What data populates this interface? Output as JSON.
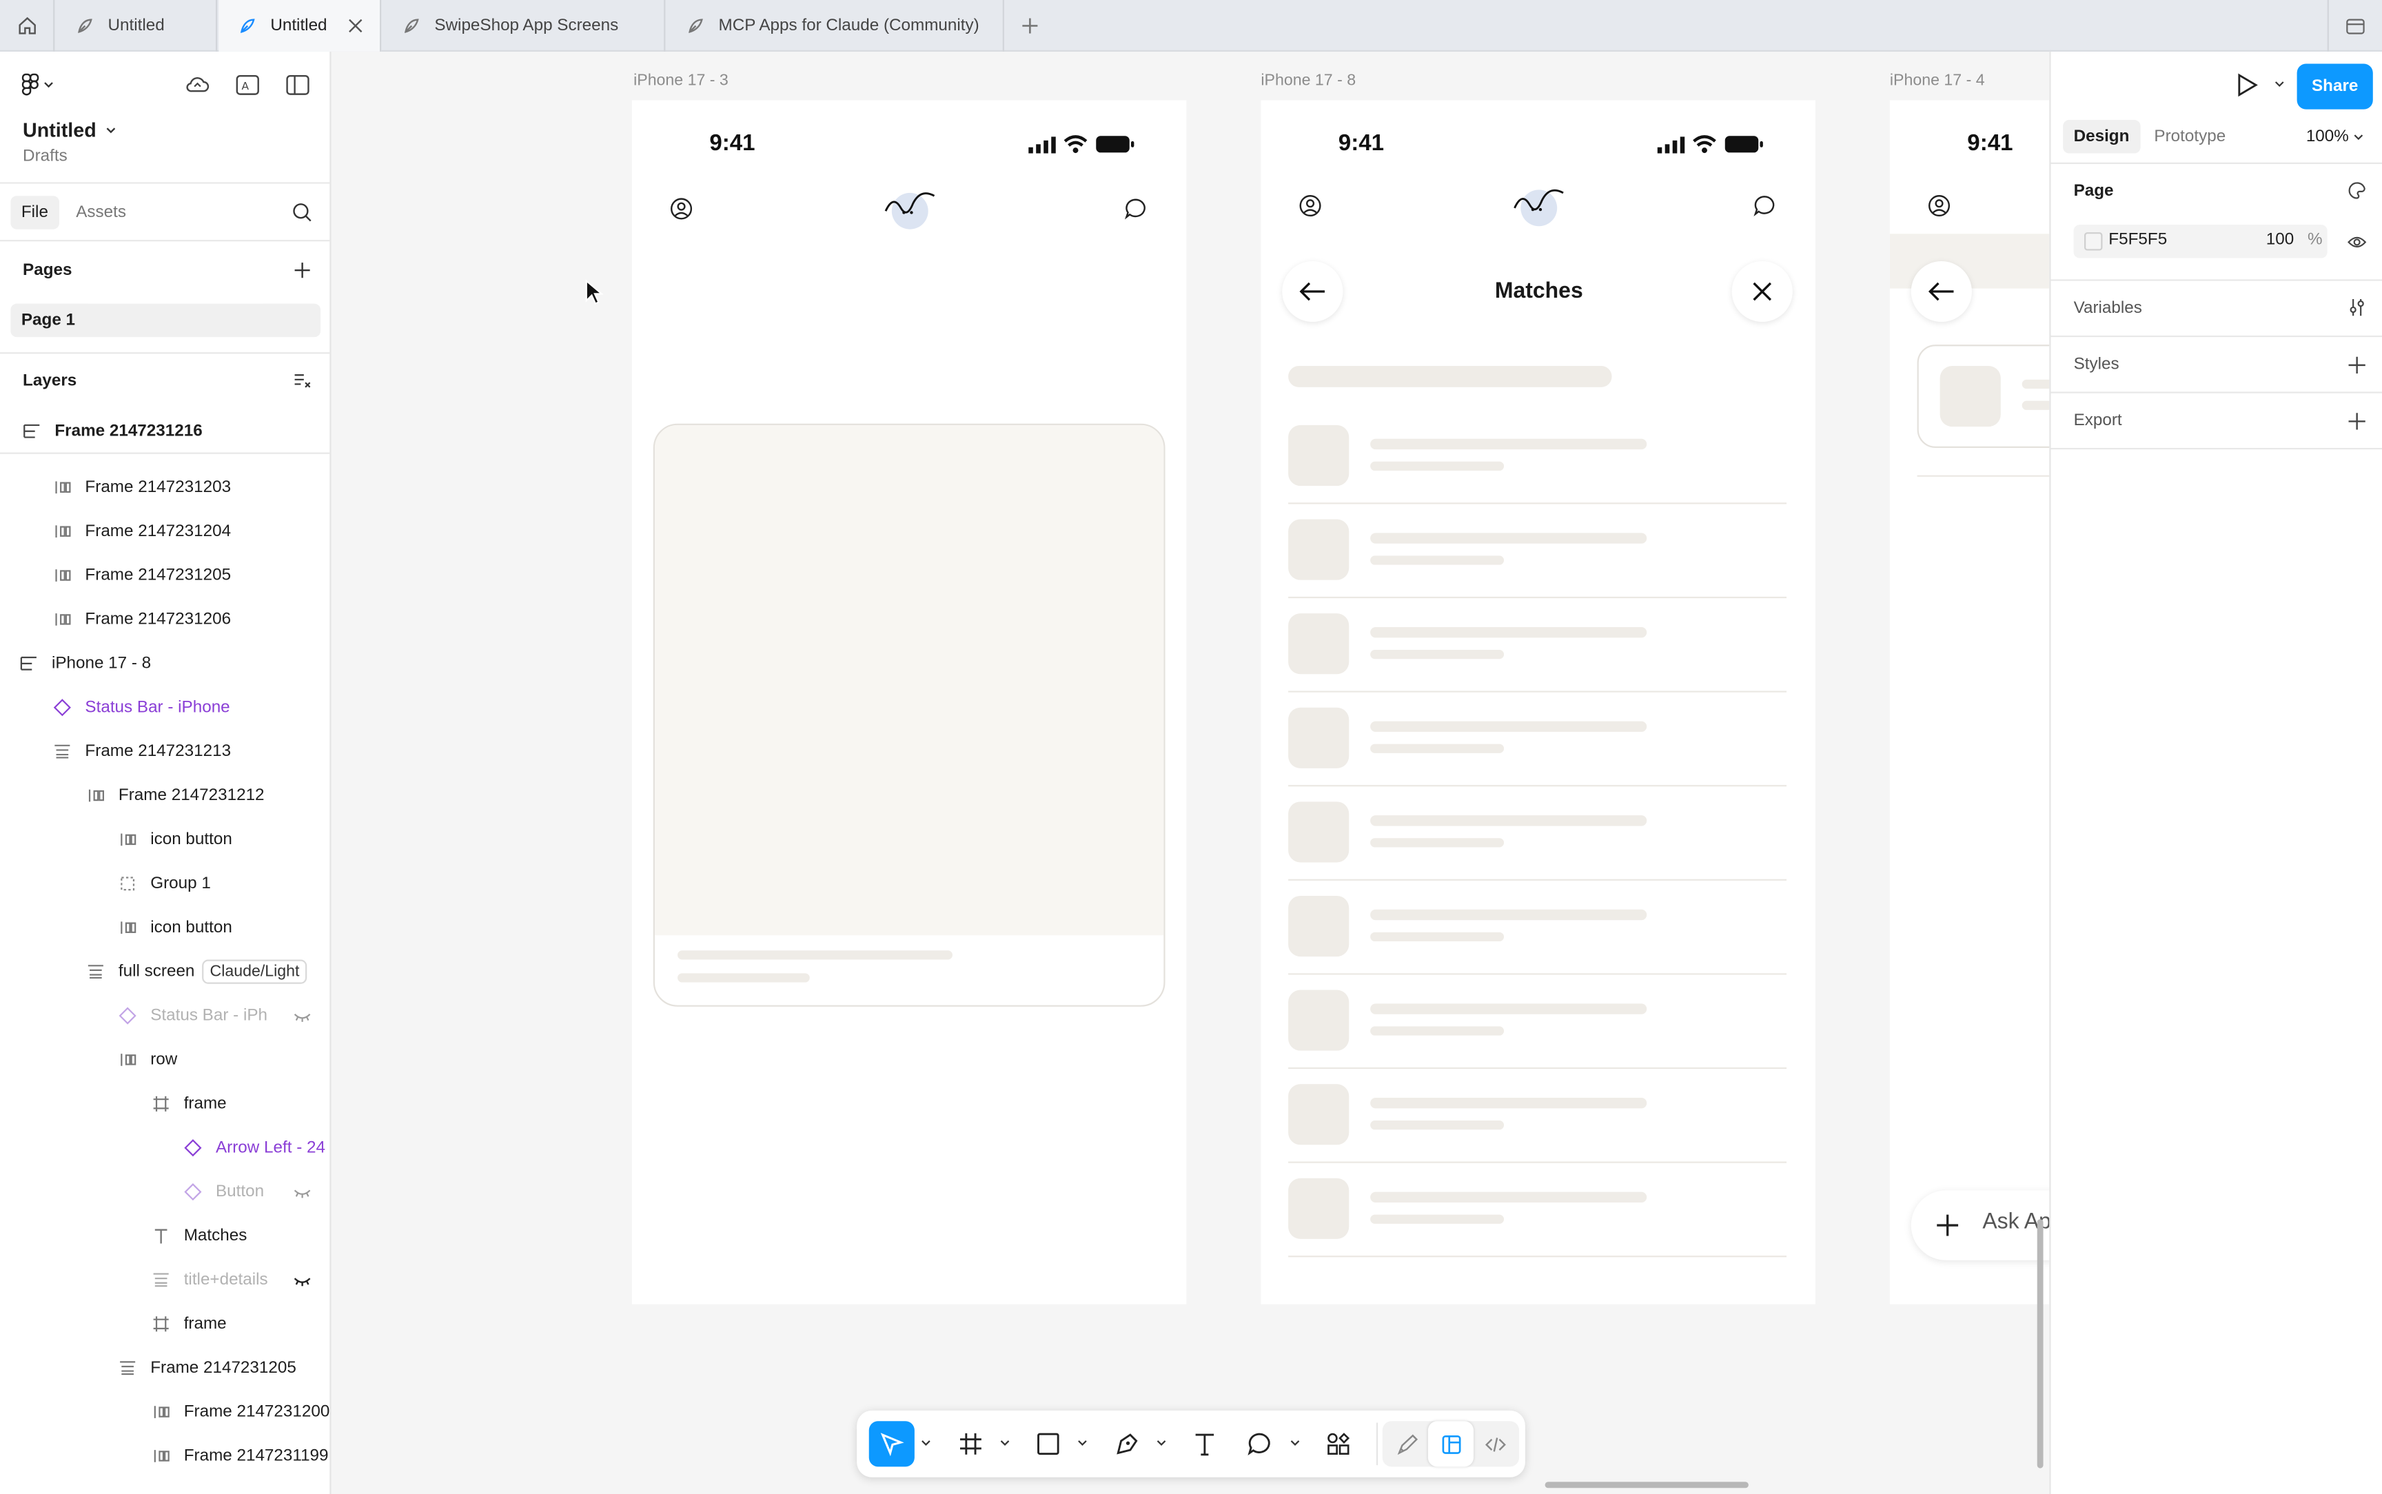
{
  "tabs": [
    {
      "label": "Untitled",
      "active": false
    },
    {
      "label": "Untitled",
      "active": true
    },
    {
      "label": "SwipeShop App Screens",
      "active": false
    },
    {
      "label": "MCP Apps for Claude (Community)",
      "active": false
    }
  ],
  "file": {
    "title": "Untitled",
    "location": "Drafts"
  },
  "left_tabs": {
    "file": "File",
    "assets": "Assets"
  },
  "pages": {
    "header": "Pages",
    "items": [
      "Page 1"
    ]
  },
  "layers": {
    "header": "Layers",
    "items": [
      {
        "label": "Frame 2147231216",
        "icon": "section-icon"
      },
      {
        "label": "Frame 2147231203",
        "icon": "auto-layout-icon"
      },
      {
        "label": "Frame 2147231204",
        "icon": "auto-layout-icon"
      },
      {
        "label": "Frame 2147231205",
        "icon": "auto-layout-icon"
      },
      {
        "label": "Frame 2147231206",
        "icon": "auto-layout-icon"
      },
      {
        "label": "iPhone 17 - 8",
        "icon": "section-icon"
      },
      {
        "label": "Status Bar - iPhone",
        "icon": "component-icon"
      },
      {
        "label": "Frame 2147231213",
        "icon": "auto-layout-icon"
      },
      {
        "label": "Frame 2147231212",
        "icon": "auto-layout-icon"
      },
      {
        "label": "icon button",
        "icon": "auto-layout-icon"
      },
      {
        "label": "Group 1",
        "icon": "group-icon"
      },
      {
        "label": "icon button",
        "icon": "auto-layout-icon"
      },
      {
        "label": "full screen",
        "icon": "auto-layout-icon",
        "chip": "Claude/Light"
      },
      {
        "label": "Status Bar - iPh",
        "icon": "component-icon"
      },
      {
        "label": "row",
        "icon": "auto-layout-icon"
      },
      {
        "label": "frame",
        "icon": "frame-icon"
      },
      {
        "label": "Arrow Left - 24",
        "icon": "component-icon"
      },
      {
        "label": "Button",
        "icon": "component-icon"
      },
      {
        "label": "Matches",
        "icon": "text-icon"
      },
      {
        "label": "title+details",
        "icon": "auto-layout-icon"
      },
      {
        "label": "frame",
        "icon": "frame-icon"
      },
      {
        "label": "Frame 2147231205",
        "icon": "auto-layout-icon"
      },
      {
        "label": "Frame 2147231200",
        "icon": "auto-layout-icon"
      },
      {
        "label": "Frame 2147231199",
        "icon": "auto-layout-icon"
      }
    ]
  },
  "canvas": {
    "frames": [
      {
        "label": "iPhone 17 - 3",
        "time": "9:41"
      },
      {
        "label": "iPhone 17 - 8",
        "time": "9:41",
        "title": "Matches"
      },
      {
        "label": "iPhone 17 - 4",
        "time": "9:41",
        "input_placeholder": "Ask Ap"
      }
    ]
  },
  "right_panel": {
    "share": "Share",
    "tabs": {
      "design": "Design",
      "prototype": "Prototype"
    },
    "zoom": "100%",
    "page_header": "Page",
    "page_fill": {
      "hex": "F5F5F5",
      "opacity": "100",
      "unit": "%"
    },
    "variables": "Variables",
    "styles": "Styles",
    "export": "Export"
  },
  "help": "?",
  "colors": {
    "accent": "#0d99ff",
    "component": "#8a3ed6",
    "skeleton": "#efece7",
    "page_bg": "#F5F5F5"
  }
}
